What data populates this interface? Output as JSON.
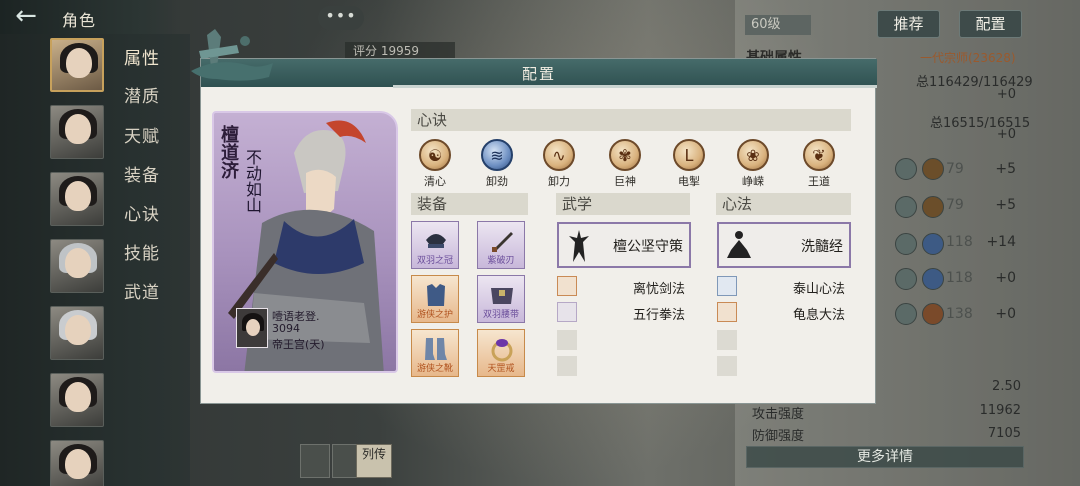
{
  "topbar": {
    "title": "角色",
    "back_icon": "arrow-left-icon"
  },
  "sidebar": {
    "tabs": [
      {
        "label": "属性"
      },
      {
        "label": "潜质"
      },
      {
        "label": "天赋"
      },
      {
        "label": "装备"
      },
      {
        "label": "心诀"
      },
      {
        "label": "技能"
      },
      {
        "label": "武道"
      }
    ]
  },
  "background": {
    "chat_icon": "•••",
    "score": "评分 19959",
    "level": "60级",
    "buttons": {
      "recommend": "推荐",
      "config": "配置"
    },
    "base_attr_title": "基础属性",
    "rank": "一代宗师(23628)",
    "hp_total": "总116429/116429",
    "hp_add": "+0",
    "mp_total": "总16515/16515",
    "mp_add": "+0",
    "attrs": [
      {
        "value": "79",
        "add": "+5"
      },
      {
        "value": "79",
        "add": "+5"
      },
      {
        "value": "118",
        "add": "+14"
      },
      {
        "value": "118",
        "add": "+0"
      },
      {
        "value": "138",
        "add": "+0"
      }
    ],
    "extra_value": "2.50",
    "attack_label": "攻击强度",
    "attack_value": "11962",
    "defense_label": "防御强度",
    "defense_value": "7105",
    "more_details": "更多详情",
    "biography": "列传"
  },
  "dialog": {
    "title": "配置",
    "hero": {
      "name": "檀道济",
      "title": "不动如山",
      "player_name": "噎语老登.",
      "player_score": "3094",
      "player_server": "帝王宫(天)"
    },
    "sections": {
      "xinjue": "心诀",
      "equipment": "装备",
      "wuxue": "武学",
      "xinfa": "心法"
    },
    "xinjue": [
      {
        "label": "清心",
        "glyph": "☯",
        "tone": "gold"
      },
      {
        "label": "卸劲",
        "glyph": "≋",
        "tone": "blue"
      },
      {
        "label": "卸力",
        "glyph": "∿",
        "tone": "gold"
      },
      {
        "label": "巨神",
        "glyph": "✾",
        "tone": "gold"
      },
      {
        "label": "电掣",
        "glyph": "ᒪ",
        "tone": "gold"
      },
      {
        "label": "峥嵘",
        "glyph": "❀",
        "tone": "gold"
      },
      {
        "label": "王道",
        "glyph": "❦",
        "tone": "gold"
      }
    ],
    "equipment": [
      {
        "label": "双羽之冠",
        "tone": "purple"
      },
      {
        "label": "紫破刃",
        "tone": "purple"
      },
      {
        "label": "游侠之护",
        "tone": "orange"
      },
      {
        "label": "双羽腰带",
        "tone": "purple"
      },
      {
        "label": "游侠之靴",
        "tone": "orange"
      },
      {
        "label": "天罡戒",
        "tone": "orange"
      }
    ],
    "wuxue": {
      "main": "檀公坚守策",
      "subs": [
        "离忧剑法",
        "五行拳法"
      ]
    },
    "xinfa": {
      "main": "洗髓经",
      "subs": [
        "泰山心法",
        "龟息大法"
      ]
    }
  }
}
